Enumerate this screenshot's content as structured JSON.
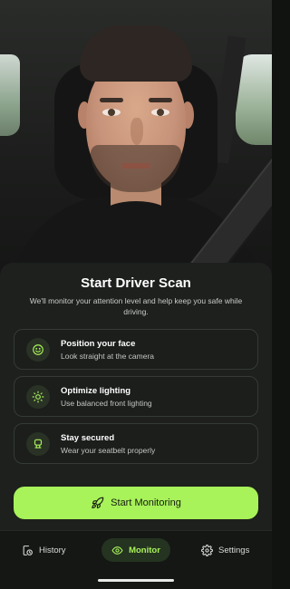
{
  "scan": {
    "title": "Start Driver Scan",
    "subtitle": "We'll monitor your attention level and help keep you safe while driving."
  },
  "tips": [
    {
      "icon": "smile-face-icon",
      "title": "Position your face",
      "desc": "Look straight at the camera"
    },
    {
      "icon": "sun-icon",
      "title": "Optimize lighting",
      "desc": "Use balanced front lighting"
    },
    {
      "icon": "seatbelt-icon",
      "title": "Stay secured",
      "desc": "Wear your seatbelt properly"
    }
  ],
  "cta": {
    "label": "Start Monitoring",
    "icon": "rocket-icon"
  },
  "nav": {
    "history": "History",
    "monitor": "Monitor",
    "settings": "Settings",
    "active": "monitor"
  },
  "colors": {
    "accent": "#a8f25a",
    "background": "#111311",
    "sheet": "#1d201d",
    "nav_active_bg": "#253321"
  }
}
